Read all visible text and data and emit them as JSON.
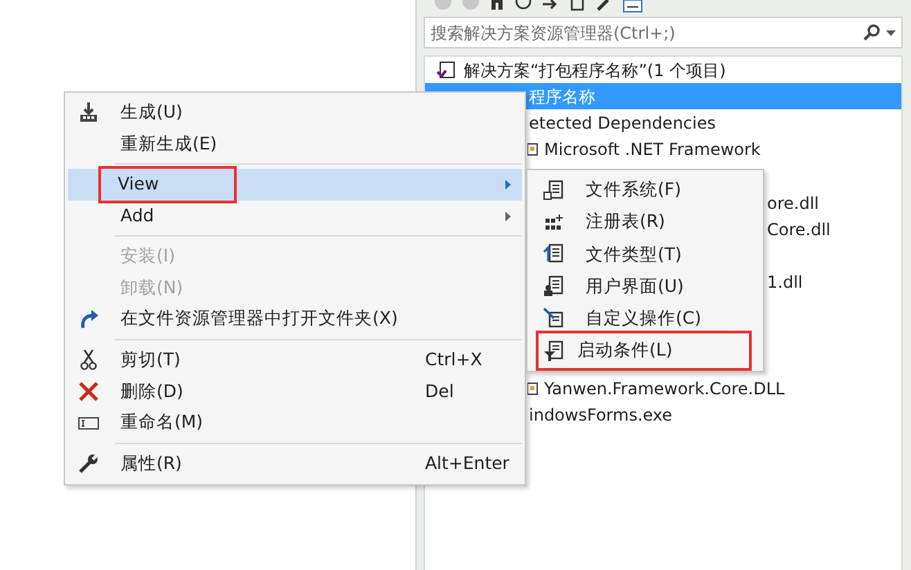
{
  "search": {
    "placeholder": "搜索解决方案资源管理器(Ctrl+;)"
  },
  "tree": [
    {
      "kind": "full",
      "text": "解决方案“打包程序名称”(1 个项目)",
      "selected": false
    },
    {
      "kind": "project",
      "text": "程序名称",
      "selected": true
    },
    {
      "kind": "cut-left",
      "text": "etected Dependencies",
      "selected": false
    },
    {
      "kind": "cut-left-icon",
      "text": "Microsoft .NET Framework",
      "selected": false
    },
    {
      "kind": "hidden"
    },
    {
      "kind": "cut-right",
      "text": "ore.dll",
      "selected": false
    },
    {
      "kind": "cut-right",
      "text": "Core.dll",
      "selected": false
    },
    {
      "kind": "hidden"
    },
    {
      "kind": "cut-right",
      "text": "1.dll",
      "selected": false
    },
    {
      "kind": "hidden"
    },
    {
      "kind": "hidden"
    },
    {
      "kind": "hidden"
    },
    {
      "kind": "cut-left-icon",
      "text": "Yanwen.Framework.Core.DLL",
      "selected": false
    },
    {
      "kind": "cut-left",
      "text": "indowsForms.exe",
      "selected": false
    }
  ],
  "context_menu": [
    {
      "kind": "item",
      "label": "生成(U)",
      "disabled": false,
      "selected": false,
      "highlighted": false
    },
    {
      "kind": "item",
      "label": "重新生成(E)",
      "disabled": false,
      "selected": false,
      "highlighted": false
    },
    {
      "kind": "separator"
    },
    {
      "kind": "submenu",
      "label": "View",
      "disabled": false,
      "selected": true,
      "highlighted": true
    },
    {
      "kind": "submenu",
      "label": "Add",
      "disabled": false,
      "selected": false,
      "highlighted": false
    },
    {
      "kind": "separator"
    },
    {
      "kind": "item",
      "label": "安装(I)",
      "disabled": true,
      "selected": false,
      "highlighted": false
    },
    {
      "kind": "item",
      "label": "卸载(N)",
      "disabled": true,
      "selected": false,
      "highlighted": false
    },
    {
      "kind": "item",
      "label": "在文件资源管理器中打开文件夹(X)",
      "disabled": false,
      "selected": false,
      "highlighted": false
    },
    {
      "kind": "separator"
    },
    {
      "kind": "item",
      "label": "剪切(T)",
      "shortcut": "Ctrl+X",
      "disabled": false,
      "selected": false,
      "highlighted": false
    },
    {
      "kind": "item",
      "label": "删除(D)",
      "shortcut": "Del",
      "disabled": false,
      "selected": false,
      "highlighted": false
    },
    {
      "kind": "item",
      "label": "重命名(M)",
      "disabled": false,
      "selected": false,
      "highlighted": false
    },
    {
      "kind": "separator"
    },
    {
      "kind": "item",
      "label": "属性(R)",
      "shortcut": "Alt+Enter",
      "disabled": false,
      "selected": false,
      "highlighted": false
    }
  ],
  "view_submenu": [
    {
      "label": "文件系统(F)",
      "highlighted": false
    },
    {
      "label": "注册表(R)",
      "highlighted": false
    },
    {
      "label": "文件类型(T)",
      "highlighted": false
    },
    {
      "label": "用户界面(U)",
      "highlighted": false
    },
    {
      "label": "自定义操作(C)",
      "highlighted": false
    },
    {
      "label": "启动条件(L)",
      "highlighted": true
    }
  ]
}
